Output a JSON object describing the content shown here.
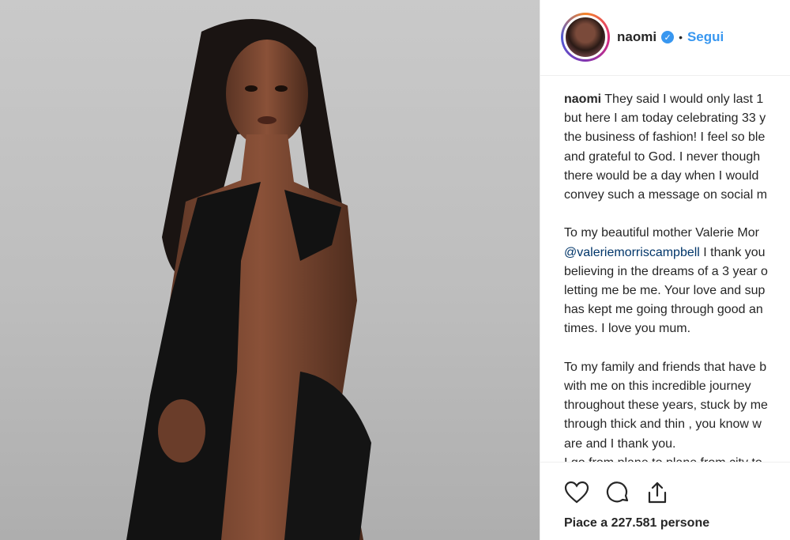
{
  "post": {
    "user": {
      "username": "naomi",
      "separator": "•",
      "follow_label": "Segui"
    },
    "caption": {
      "author": "naomi",
      "lines": [
        " They said I would only last 1",
        "but here I am today celebrating 33 y",
        "the business of fashion! I feel so ble",
        "and grateful to God. I never though",
        "there would be a day when I would",
        "convey such a message on social m",
        "",
        "To my beautiful mother Valerie Mor",
        "@valeriemorriscampbell",
        " I thank you",
        "believing in the dreams of a 3 year o",
        "letting me be me. Your love and sup",
        "has kept me going through good an",
        "times. I love you mum.",
        "",
        "To my family and friends that have b",
        "with me on this incredible journey",
        "throughout these years, stuck by me",
        "through thick and thin , you know w",
        "are and I thank you.",
        "I go from plane to plane from city to"
      ]
    },
    "likes_text": "Piace a 227.581 persone"
  },
  "icons": [
    "heart-icon",
    "comment-icon",
    "share-icon",
    "verified-icon"
  ],
  "colors": {
    "accent": "#3897f0",
    "mention": "#003569",
    "text": "#262626"
  }
}
